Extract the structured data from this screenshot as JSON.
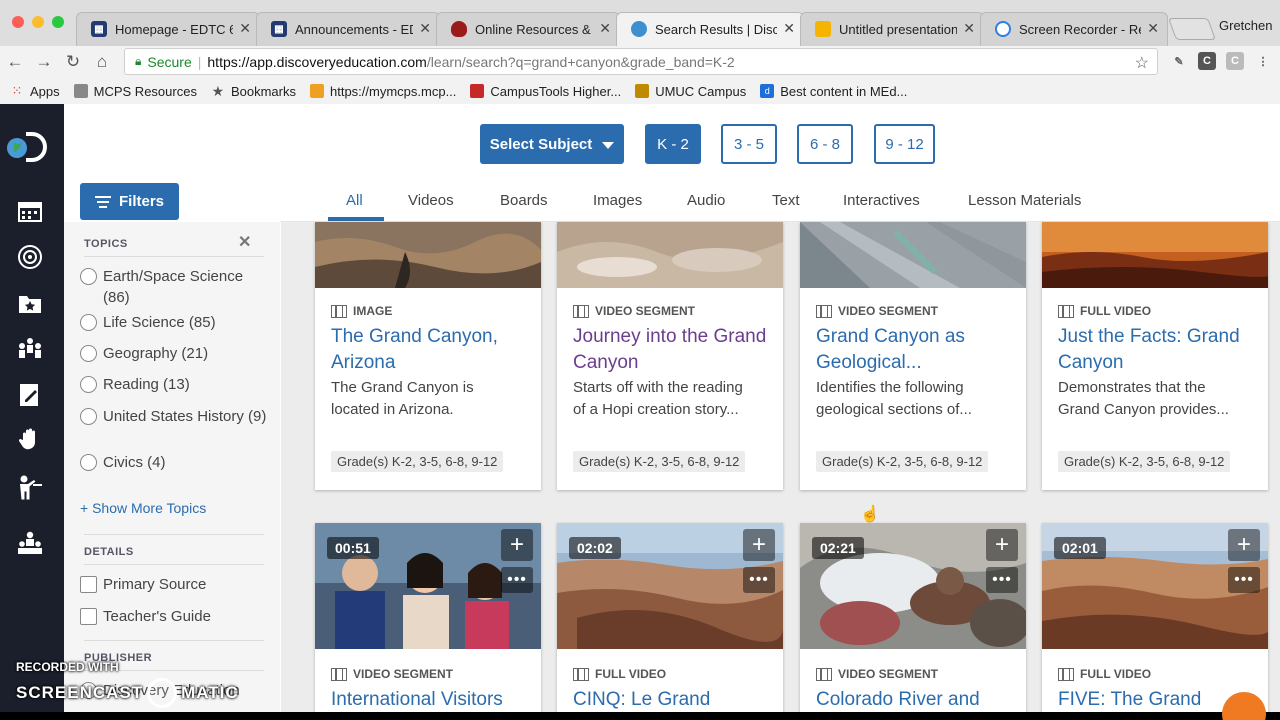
{
  "browser": {
    "tabs": [
      {
        "label": "Homepage - EDTC 6",
        "favicon": "edtc-icon",
        "color": "#243a73"
      },
      {
        "label": "Announcements - ED",
        "favicon": "edtc-icon",
        "color": "#243a73"
      },
      {
        "label": "Online Resources & t",
        "favicon": "shield-icon",
        "color": "#9b1b1b"
      },
      {
        "label": "Search Results | Disc",
        "favicon": "globe-icon",
        "color": "#3e8fcf"
      },
      {
        "label": "Untitled presentation",
        "favicon": "slides-icon",
        "color": "#f4b400"
      },
      {
        "label": "Screen Recorder - Re",
        "favicon": "record-icon",
        "color": "#2d7fe0"
      }
    ],
    "profile": "Gretchen",
    "url": {
      "secure_label": "Secure",
      "host": "https://app.discoveryeducation.com",
      "path": "/learn/search?q=grand+canyon&grade_band=K-2"
    },
    "bookmarks": [
      {
        "label": "Apps",
        "icon": "apps-grid-icon",
        "color": "#d44"
      },
      {
        "label": "MCPS Resources",
        "icon": "folder-icon",
        "color": "#888"
      },
      {
        "label": "Bookmarks",
        "icon": "star-icon",
        "color": "#555"
      },
      {
        "label": "https://mymcps.mcp...",
        "icon": "mcps-icon",
        "color": "#f0a020"
      },
      {
        "label": "CampusTools Higher...",
        "icon": "campustools-icon",
        "color": "#c62828"
      },
      {
        "label": "UMUC Campus",
        "icon": "umuc-icon",
        "color": "#c08a00"
      },
      {
        "label": "Best content in MEd...",
        "icon": "d-icon",
        "color": "#1e6fd9"
      }
    ]
  },
  "grades": {
    "subject_label": "Select Subject",
    "bands": [
      "K - 2",
      "3 - 5",
      "6 - 8",
      "9 - 12"
    ],
    "active": "K - 2"
  },
  "filters_label": "Filters",
  "type_tabs": [
    "All",
    "Videos",
    "Boards",
    "Images",
    "Audio",
    "Text",
    "Interactives",
    "Lesson Materials"
  ],
  "active_type": "All",
  "filters": {
    "topics_heading": "TOPICS",
    "topics": [
      {
        "label": "Earth/Space Science (86)"
      },
      {
        "label": "Life Science (85)"
      },
      {
        "label": "Geography (21)"
      },
      {
        "label": "Reading (13)"
      },
      {
        "label": "United States History (9)"
      },
      {
        "label": "Civics (4)"
      }
    ],
    "show_more": "Show More Topics",
    "details_heading": "DETAILS",
    "details": [
      "Primary Source",
      "Teacher's Guide"
    ],
    "publisher_heading": "PUBLISHER",
    "publisher_partial": "Discovery Education"
  },
  "results": [
    {
      "type": "IMAGE",
      "title": "The Grand Canyon, Arizona",
      "desc1": "The Grand Canyon is",
      "desc2": "located in Arizona.",
      "grades": "Grade(s) K-2, 3-5, 6-8, 9-12",
      "visited": false
    },
    {
      "type": "VIDEO SEGMENT",
      "title": "Journey into the Grand Canyon",
      "desc1": "Starts off with the reading",
      "desc2": "of a Hopi creation story...",
      "grades": "Grade(s) K-2, 3-5, 6-8, 9-12",
      "visited": true
    },
    {
      "type": "VIDEO SEGMENT",
      "title": "Grand Canyon as Geological...",
      "desc1": "Identifies the following",
      "desc2": "geological sections of...",
      "grades": "Grade(s) K-2, 3-5, 6-8, 9-12",
      "visited": false
    },
    {
      "type": "FULL VIDEO",
      "title": "Just the Facts: Grand Canyon",
      "desc1": "Demonstrates that the",
      "desc2": "Grand Canyon provides...",
      "grades": "Grade(s) K-2, 3-5, 6-8, 9-12",
      "visited": false
    },
    {
      "type": "VIDEO SEGMENT",
      "title": "International Visitors",
      "duration": "00:51"
    },
    {
      "type": "FULL VIDEO",
      "title": "CINQ: Le Grand",
      "duration": "02:02"
    },
    {
      "type": "VIDEO SEGMENT",
      "title": "Colorado River and",
      "duration": "02:21"
    },
    {
      "type": "FULL VIDEO",
      "title": "FIVE: The Grand",
      "duration": "02:01"
    }
  ],
  "watermark": {
    "line1": "RECORDED WITH",
    "line2a": "SCREENCAST",
    "line2b": "MATIC"
  },
  "colors": {
    "brand": "#2b6cae",
    "visited": "#6b3d8f",
    "rail": "#1b1f2b"
  }
}
